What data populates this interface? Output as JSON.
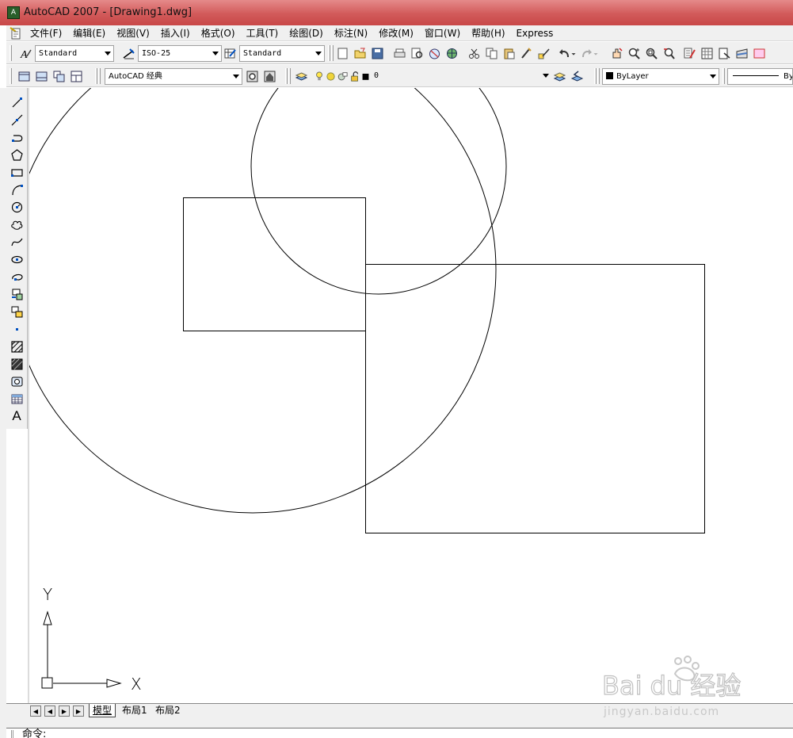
{
  "window": {
    "title": "AutoCAD 2007 - [Drawing1.dwg]"
  },
  "menubar": {
    "items": [
      "文件(F)",
      "编辑(E)",
      "视图(V)",
      "插入(I)",
      "格式(O)",
      "工具(T)",
      "绘图(D)",
      "标注(N)",
      "修改(M)",
      "窗口(W)",
      "帮助(H)",
      "Express"
    ]
  },
  "styles_toolbar": {
    "text_style": "Standard",
    "dim_style": "ISO-25",
    "table_style": "Standard"
  },
  "workspace_toolbar": {
    "workspace": "AutoCAD 经典",
    "layer": "0",
    "color": "ByLayer",
    "linetype": "ByL"
  },
  "colors": {
    "titlebar_accent": "#d25a5a",
    "toolbar_bg": "#f0f0f0",
    "drawing_stroke": "#000000"
  },
  "draw_toolbar": {
    "icons": [
      "line-icon",
      "construction-line-icon",
      "polyline-icon",
      "polygon-icon",
      "rectangle-icon",
      "arc-icon",
      "circle-icon",
      "revision-cloud-icon",
      "spline-icon",
      "ellipse-icon",
      "ellipse-arc-icon",
      "insert-block-icon",
      "make-block-icon",
      "point-icon",
      "hatch-icon",
      "gradient-icon",
      "region-icon",
      "table-icon",
      "multiline-text-icon"
    ],
    "text_tool_label": "A"
  },
  "ucs": {
    "x_label": "X",
    "y_label": "Y"
  },
  "layout_tabs": {
    "tabs": [
      "模型",
      "布局1",
      "布局2"
    ],
    "active": "模型"
  },
  "command_line": {
    "prompt": "命令:"
  },
  "watermark": {
    "brand": "Bai du 经验",
    "url": "jingyan.baidu.com"
  }
}
